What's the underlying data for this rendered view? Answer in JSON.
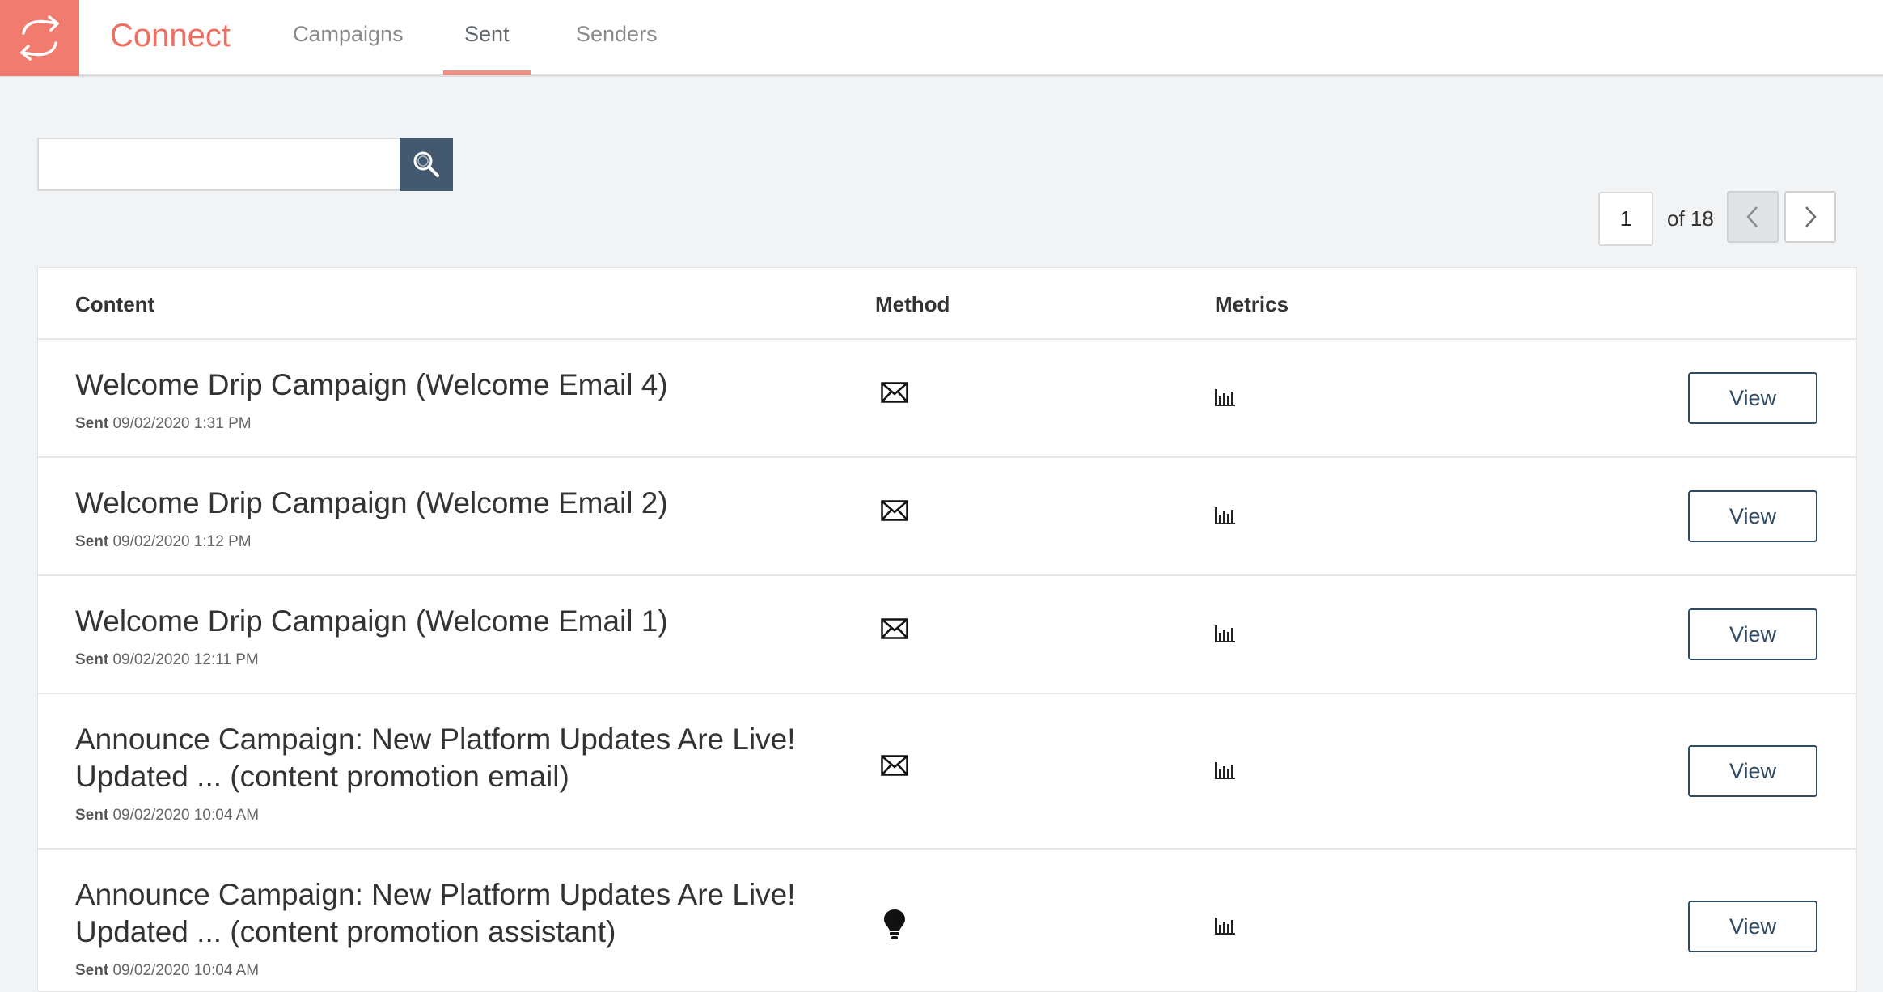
{
  "header": {
    "app_name": "Connect",
    "logo_icon": "sync-arrows-icon",
    "tabs": [
      {
        "label": "Campaigns",
        "active": false
      },
      {
        "label": "Sent",
        "active": true
      },
      {
        "label": "Senders",
        "active": false
      }
    ],
    "accent_color": "#f07b6e"
  },
  "search": {
    "value": "",
    "placeholder": "",
    "button_icon": "search-icon"
  },
  "pagination": {
    "current_page": "1",
    "total_label": "of 18",
    "prev_icon": "chevron-left-icon",
    "next_icon": "chevron-right-icon"
  },
  "table": {
    "columns": [
      "Content",
      "Method",
      "Metrics"
    ],
    "rows": [
      {
        "title": "Welcome Drip Campaign (Welcome Email 4)",
        "sent_label": "Sent",
        "sent_time": "09/02/2020 1:31 PM",
        "method_icon": "envelope-icon",
        "metrics_icon": "bar-chart-icon",
        "action": "View"
      },
      {
        "title": "Welcome Drip Campaign (Welcome Email 2)",
        "sent_label": "Sent",
        "sent_time": "09/02/2020 1:12 PM",
        "method_icon": "envelope-icon",
        "metrics_icon": "bar-chart-icon",
        "action": "View"
      },
      {
        "title": "Welcome Drip Campaign (Welcome Email 1)",
        "sent_label": "Sent",
        "sent_time": "09/02/2020 12:11 PM",
        "method_icon": "envelope-icon",
        "metrics_icon": "bar-chart-icon",
        "action": "View"
      },
      {
        "title_line1": "Announce Campaign: New Platform Updates Are Live!",
        "title_line2": "Updated ... (content promotion email)",
        "sent_label": "Sent",
        "sent_time": "09/02/2020 10:04 AM",
        "method_icon": "envelope-icon",
        "metrics_icon": "bar-chart-icon",
        "action": "View"
      },
      {
        "title_line1": "Announce Campaign: New Platform Updates Are Live!",
        "title_line2": "Updated ... (content promotion assistant)",
        "sent_label": "Sent",
        "sent_time": "09/02/2020 10:04 AM",
        "method_icon": "lightbulb-icon",
        "metrics_icon": "bar-chart-icon",
        "action": "View"
      }
    ]
  }
}
